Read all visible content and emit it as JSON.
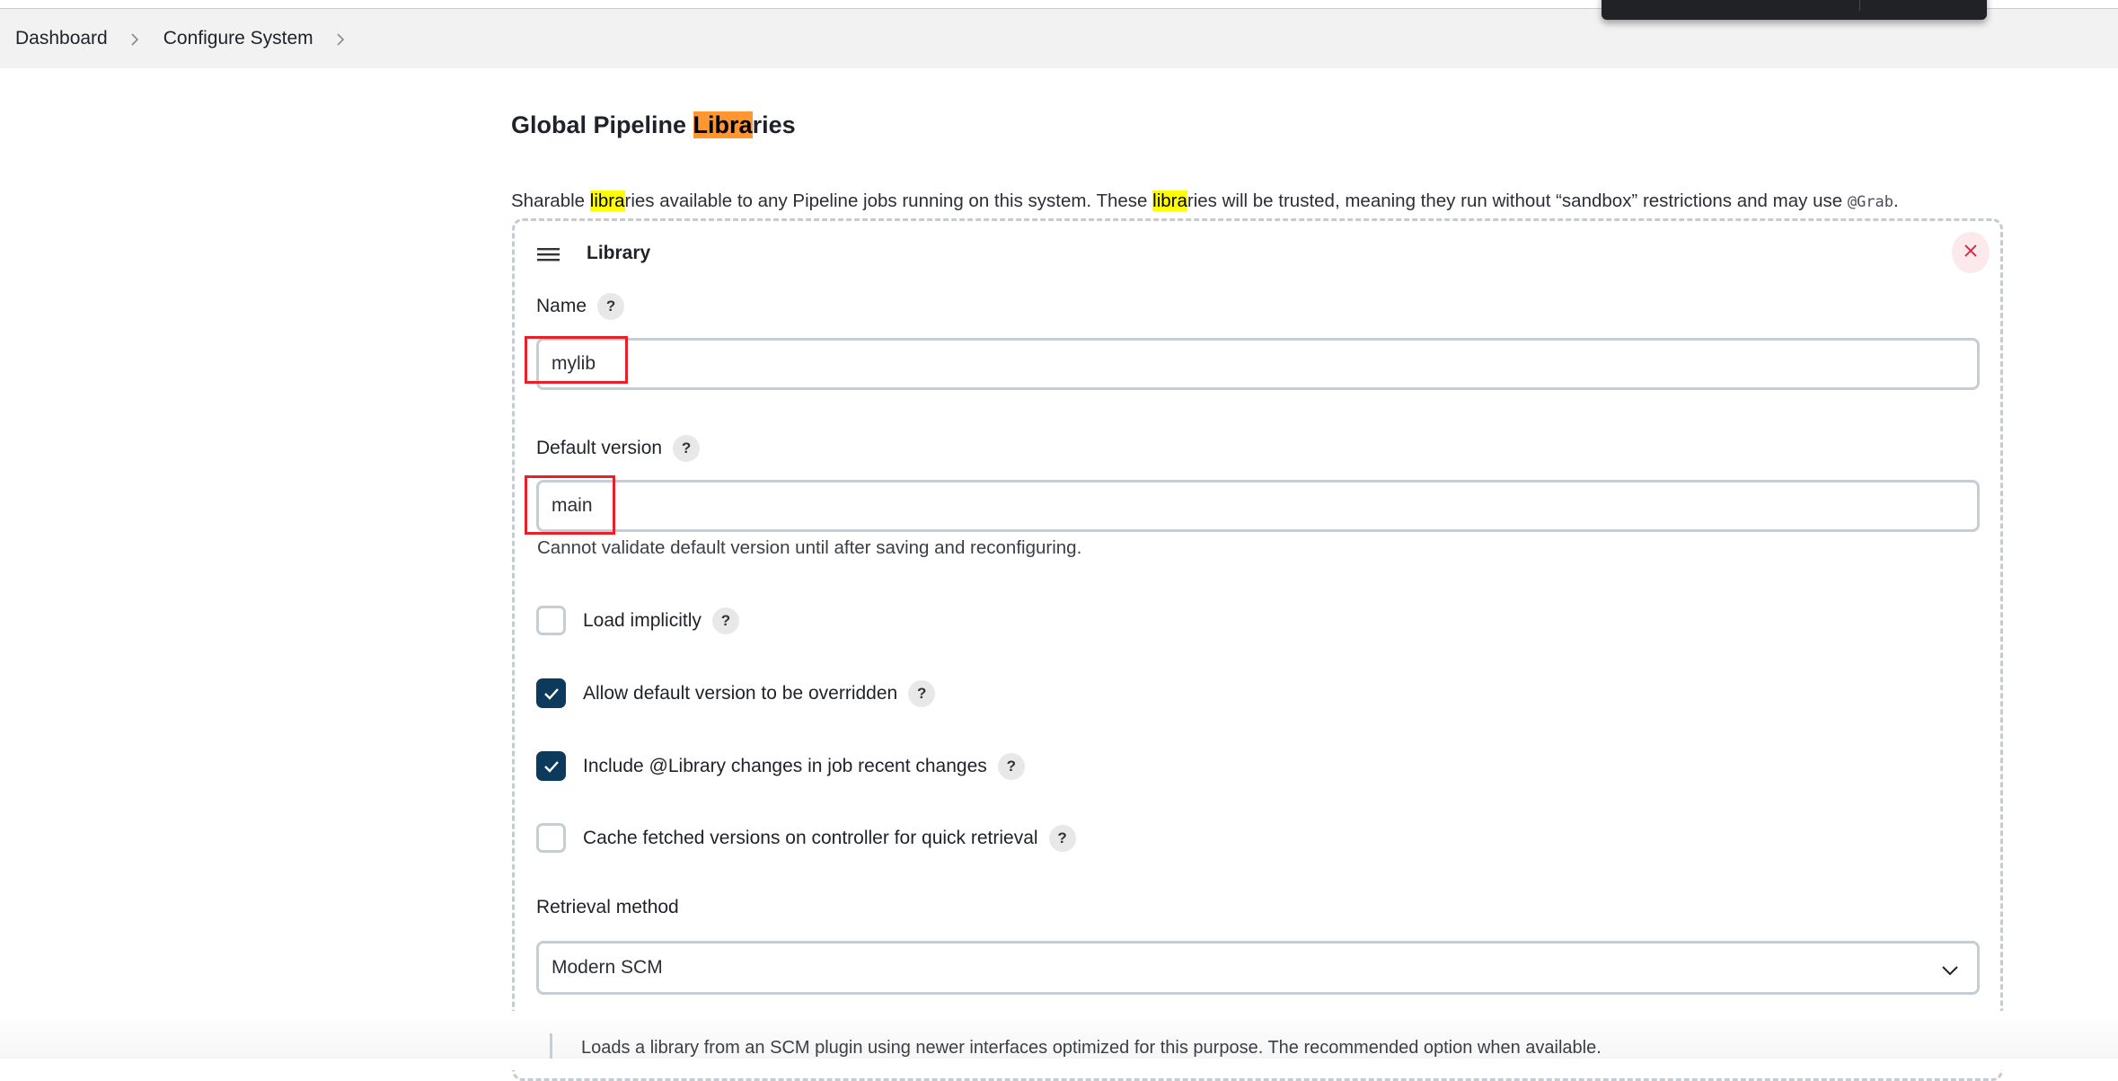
{
  "breadcrumb": {
    "items": [
      {
        "label": "Dashboard"
      },
      {
        "label": "Configure System"
      }
    ]
  },
  "section": {
    "title_pre": "Global Pipeline ",
    "title_highlight": "Libra",
    "title_post": "ries",
    "description": {
      "part1": "Sharable ",
      "hl1": "libra",
      "part2": "ries available to any Pipeline jobs running on this system. These ",
      "hl2": "libra",
      "part3": "ries will be trusted, meaning they run without “sandbox” restrictions and may use ",
      "code": "@Grab",
      "part4": "."
    },
    "colors": {
      "search_highlight_current": "#ff9632",
      "search_highlight": "#ffff00"
    }
  },
  "library": {
    "title": "Library",
    "delete_icon": "close-icon",
    "drag_icon": "hamburger-icon",
    "name": {
      "label": "Name",
      "help": "?",
      "value": "mylib"
    },
    "default_version": {
      "label": "Default version",
      "help": "?",
      "value": "main",
      "hint": "Cannot validate default version until after saving and reconfiguring."
    },
    "options": [
      {
        "label": "Load implicitly",
        "checked": false,
        "help": "?"
      },
      {
        "label": "Allow default version to be overridden",
        "checked": true,
        "help": "?"
      },
      {
        "label": "Include @Library changes in job recent changes",
        "checked": true,
        "help": "?"
      },
      {
        "label": "Cache fetched versions on controller for quick retrieval",
        "checked": false,
        "help": "?"
      }
    ],
    "retrieval_method": {
      "label": "Retrieval method",
      "selected": "Modern SCM",
      "description": "Loads a library from an SCM plugin using newer interfaces optimized for this purpose. The recommended option when available."
    },
    "colors": {
      "checkbox_checked": "#0b3a5c",
      "annotation_box": "#e8202a"
    }
  }
}
